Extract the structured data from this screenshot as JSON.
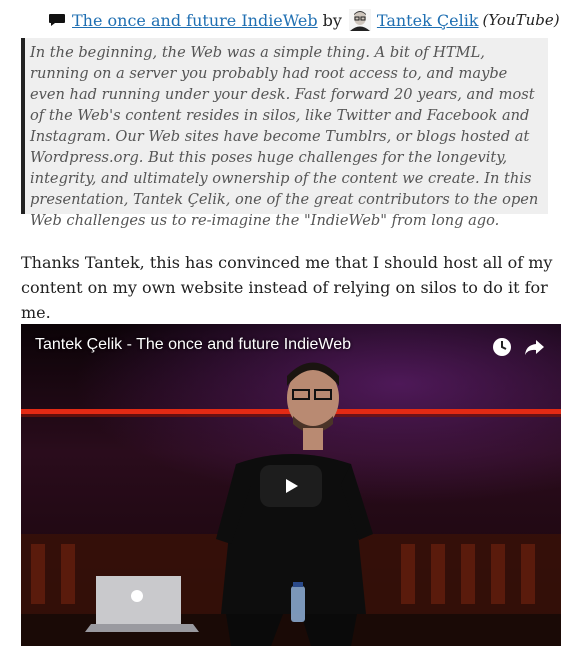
{
  "citation": {
    "icon": "speech-bubble-icon",
    "title_link": "The once and future IndieWeb",
    "by": "by",
    "author_link": "Tantek Çelik",
    "source": "(YouTube)"
  },
  "quote": {
    "text": "In the beginning, the Web was a simple thing. A bit of HTML, running on a server you probably had root access to, and maybe even had running under your desk. Fast forward 20 years, and most of the Web's content resides in silos, like Twitter and Facebook and Instagram. Our Web sites have become Tumblrs, or blogs hosted at Wordpress.org. But this poses huge challenges for the longevity, integrity, and ultimately ownership of the content we create. In this presentation, Tantek Çelik, one of the great contributors to the open Web challenges us to re-imagine the \"IndieWeb\" from long ago."
  },
  "comment": {
    "text": "Thanks Tantek, this has convinced me that I should host all of my content on my own website instead of relying on silos to do it for me."
  },
  "video": {
    "title": "Tantek Çelik - The once and future IndieWeb",
    "icons": [
      "clock-icon",
      "share-icon",
      "play-icon"
    ]
  },
  "colors": {
    "link": "#1f6fb2",
    "quote_bg": "#efefef",
    "quote_border": "#222222",
    "video_bg": "#0a0507",
    "stage_red": "#e32a14"
  }
}
